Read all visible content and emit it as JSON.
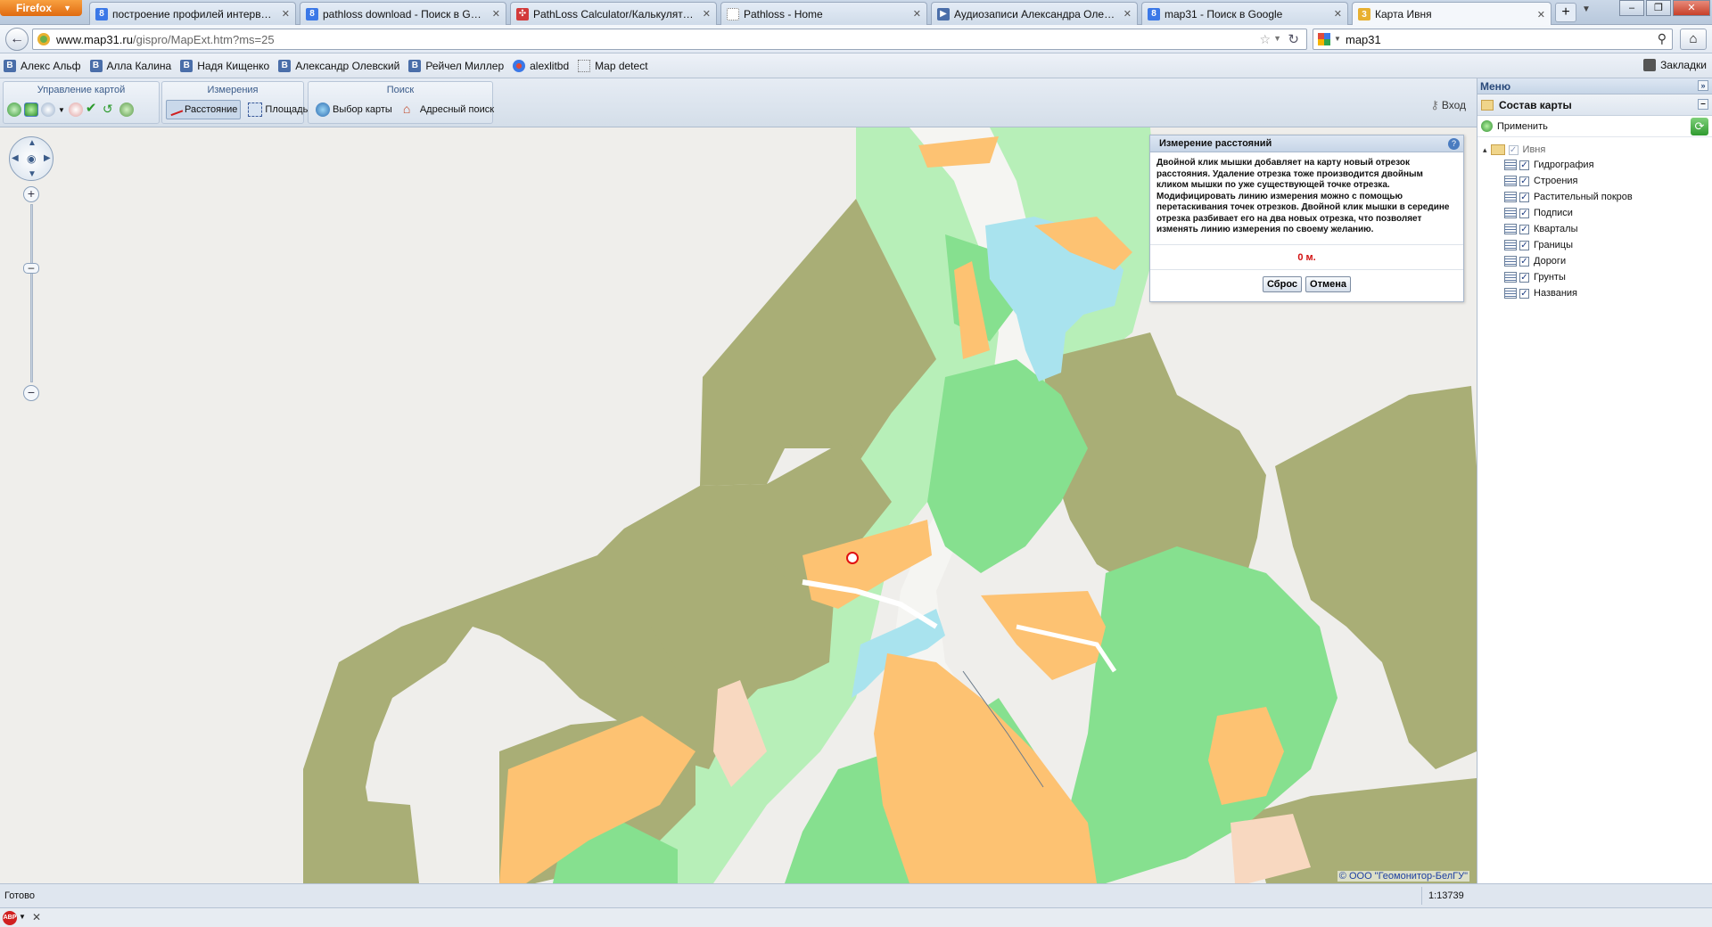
{
  "browser": {
    "app_button": "Firefox",
    "tabs": [
      {
        "title": "построение профилей интервал...",
        "icon": "google-icon",
        "color": "#3b78e7"
      },
      {
        "title": "pathloss download - Поиск в Goo...",
        "icon": "google-icon",
        "color": "#3b78e7"
      },
      {
        "title": "PathLoss Calculator/Калькулятор ...",
        "icon": "pathloss-icon",
        "color": "#d23a3a"
      },
      {
        "title": "Pathloss - Home",
        "icon": "blank-page-icon",
        "color": "#ffffff"
      },
      {
        "title": "Аудиозаписи Александра Олевск...",
        "icon": "vk-icon",
        "color": "#4a6ea9"
      },
      {
        "title": "map31 - Поиск в Google",
        "icon": "google-icon",
        "color": "#3b78e7"
      },
      {
        "title": "Карта Ивня",
        "icon": "map31-icon",
        "color": "#e8b030"
      }
    ],
    "url_host": "www.map31.ru",
    "url_path": "/gispro/MapExt.htm?ms=25",
    "search_value": "map31"
  },
  "bookmarks": {
    "items": [
      "Алекс Альф",
      "Алла Калина",
      "Надя Кищенко",
      "Александр Олевский",
      "Рейчел Миллер",
      "alexlitbd",
      "Map detect"
    ],
    "right_label": "Закладки"
  },
  "toolbar": {
    "group_map": "Управление картой",
    "group_measure": "Измерения",
    "group_search": "Поиск",
    "distance": "Расстояние",
    "area": "Площадь",
    "choose_map": "Выбор карты",
    "address_search": "Адресный поиск",
    "login": "Вход"
  },
  "measure": {
    "title": "Измерение расстояний",
    "help": "?",
    "text": "Двойной клик мышки добавляет на карту новый отрезок расстояния. Удаление отрезка тоже производится двойным кликом мышки по уже существующей точке отрезка. Модифицировать линию измерения можно с помощью перетаскивания точек отрезков. Двойной клик мышки в середине отрезка разбивает его на два новых отрезка, что позволяет изменять линию измерения по своему желанию.",
    "value": "0 м.",
    "reset": "Сброс",
    "cancel": "Отмена"
  },
  "panel": {
    "menu": "Меню",
    "section": "Состав карты",
    "apply": "Применить",
    "root": "Ивня",
    "layers": [
      "Гидрография",
      "Строения",
      "Растительный покров",
      "Подписи",
      "Кварталы",
      "Границы",
      "Дороги",
      "Грунты",
      "Названия"
    ]
  },
  "map": {
    "copyright": "© ООО \"Геомонитор-БелГУ\""
  },
  "status": {
    "text": "Готово",
    "scale": "1:13739"
  },
  "colors": {
    "forest": "#a9ae76",
    "meadow": "#b7efb8",
    "grass": "#86e08f",
    "settlement": "#fdc272",
    "water": "#a9e3ee",
    "road": "#f5f5f2"
  }
}
